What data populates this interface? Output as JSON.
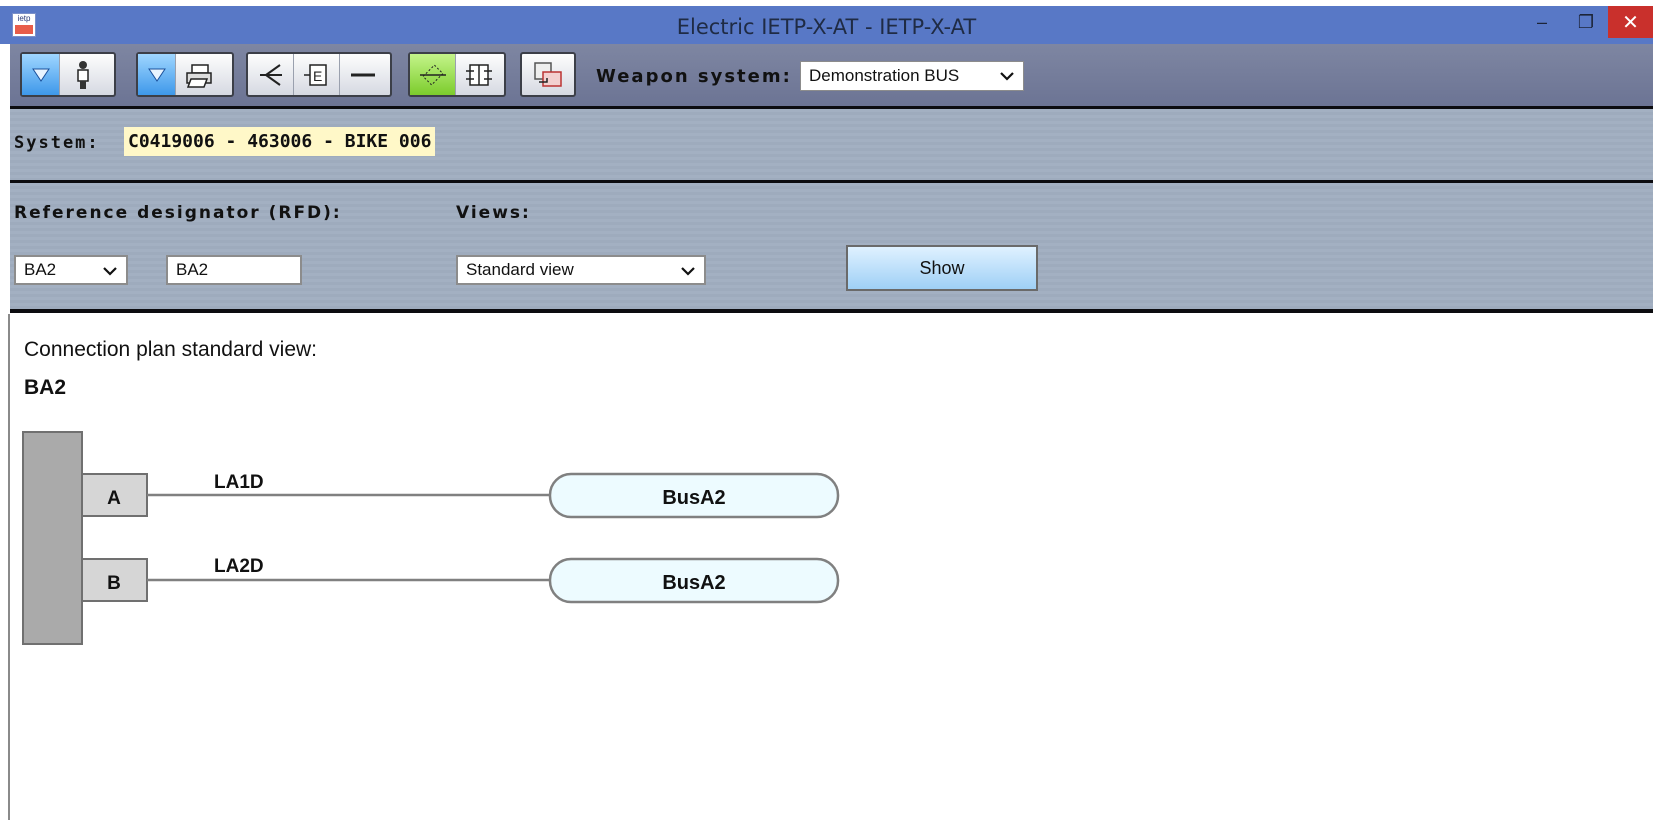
{
  "window": {
    "title": "Electric IETP-X-AT - IETP-X-AT",
    "logo_text": "ietp",
    "minimize_glyph": "–",
    "maximize_glyph": "❐",
    "close_glyph": "✕"
  },
  "toolbar": {
    "weapon_system_label": "Weapon system:",
    "weapon_system_value": "Demonstration BUS",
    "icons": [
      "dropdown-icon",
      "person-icon",
      "dropdown-icon",
      "printer-icon",
      "branch-icon",
      "e-symbol-icon",
      "line-icon",
      "pattern-icon",
      "compare-icon",
      "export-icon"
    ]
  },
  "system": {
    "label": "System:",
    "value": "C0419006 - 463006 - BIKE 006"
  },
  "filters": {
    "rfd_label": "Reference designator (RFD):",
    "rfd_select": "BA2",
    "rfd_input": "BA2",
    "views_label": "Views:",
    "views_select": "Standard view",
    "show_label": "Show"
  },
  "plan": {
    "title": "Connection plan standard view:",
    "rfd": "BA2",
    "connections": [
      {
        "pin": "A",
        "wire": "LA1D",
        "target": "BusA2"
      },
      {
        "pin": "B",
        "wire": "LA2D",
        "target": "BusA2"
      }
    ]
  },
  "colors": {
    "titlebar": "#5878c6",
    "close": "#c9302c",
    "system_highlight": "#fff8c8",
    "bus_fill": "#edfbff",
    "connector_fill": "#aaaaaa"
  }
}
